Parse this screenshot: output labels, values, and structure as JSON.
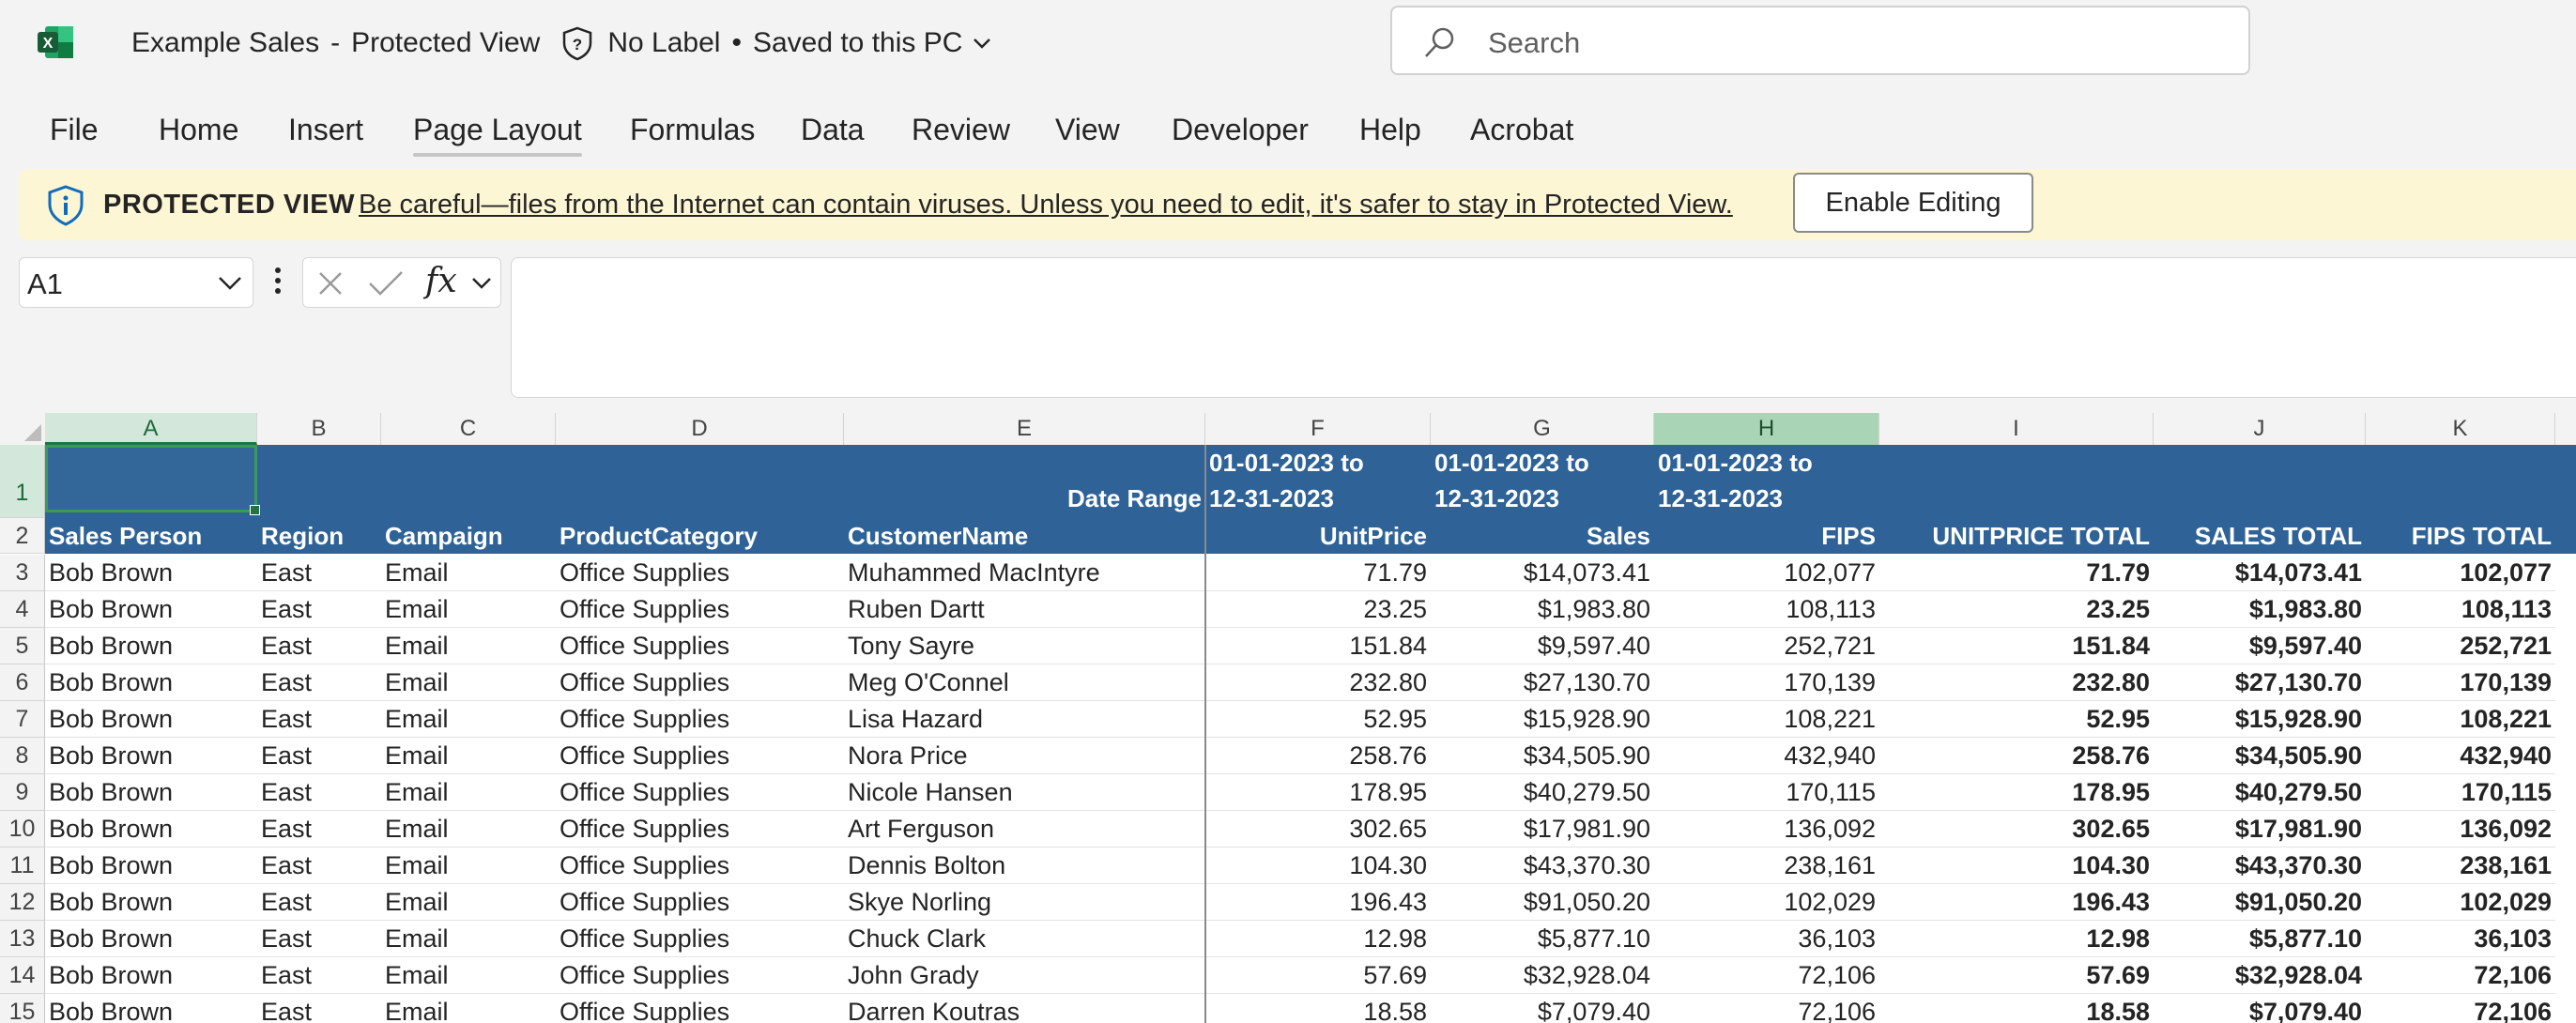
{
  "app": {
    "doc_name": "Example Sales",
    "separator": "-",
    "view_mode": "Protected View",
    "label": "No Label",
    "bullet": "•",
    "save_status": "Saved to this PC",
    "search_placeholder": "Search"
  },
  "ribbon_tabs": [
    "File",
    "Home",
    "Insert",
    "Page Layout",
    "Formulas",
    "Data",
    "Review",
    "View",
    "Developer",
    "Help",
    "Acrobat"
  ],
  "active_tab": "Page Layout",
  "protected_view": {
    "title": "PROTECTED VIEW",
    "message": "Be careful—files from the Internet can contain viruses. Unless you need to edit, it's safer to stay in Protected View.",
    "button": "Enable Editing"
  },
  "formula_bar": {
    "name_box": "A1",
    "fx": "fx",
    "formula": ""
  },
  "columns": [
    "A",
    "B",
    "C",
    "D",
    "E",
    "F",
    "G",
    "H",
    "I",
    "J",
    "K"
  ],
  "highlighted_column": "H",
  "row_numbers": [
    "1",
    "2",
    "3",
    "4",
    "5",
    "6",
    "7",
    "8",
    "9",
    "10",
    "11",
    "12",
    "13",
    "14",
    "15"
  ],
  "header_row1": {
    "date_range_label": "Date Range",
    "F_line1": "01-01-2023 to",
    "F_line2": "12-31-2023",
    "G_line1": "01-01-2023 to",
    "G_line2": "12-31-2023",
    "H_line1": "01-01-2023 to",
    "H_line2": "12-31-2023"
  },
  "header_row2": [
    "Sales Person",
    "Region",
    "Campaign",
    "ProductCategory",
    "CustomerName",
    "UnitPrice",
    "Sales",
    "FIPS",
    "UNITPRICE TOTAL",
    "SALES TOTAL",
    "FIPS TOTAL"
  ],
  "rows": [
    [
      "Bob Brown",
      "East",
      "Email",
      "Office Supplies",
      "Muhammed MacIntyre",
      "71.79",
      "$14,073.41",
      "102,077",
      "71.79",
      "$14,073.41",
      "102,077"
    ],
    [
      "Bob Brown",
      "East",
      "Email",
      "Office Supplies",
      "Ruben Dartt",
      "23.25",
      "$1,983.80",
      "108,113",
      "23.25",
      "$1,983.80",
      "108,113"
    ],
    [
      "Bob Brown",
      "East",
      "Email",
      "Office Supplies",
      "Tony Sayre",
      "151.84",
      "$9,597.40",
      "252,721",
      "151.84",
      "$9,597.40",
      "252,721"
    ],
    [
      "Bob Brown",
      "East",
      "Email",
      "Office Supplies",
      "Meg O'Connel",
      "232.80",
      "$27,130.70",
      "170,139",
      "232.80",
      "$27,130.70",
      "170,139"
    ],
    [
      "Bob Brown",
      "East",
      "Email",
      "Office Supplies",
      "Lisa Hazard",
      "52.95",
      "$15,928.90",
      "108,221",
      "52.95",
      "$15,928.90",
      "108,221"
    ],
    [
      "Bob Brown",
      "East",
      "Email",
      "Office Supplies",
      "Nora Price",
      "258.76",
      "$34,505.90",
      "432,940",
      "258.76",
      "$34,505.90",
      "432,940"
    ],
    [
      "Bob Brown",
      "East",
      "Email",
      "Office Supplies",
      "Nicole Hansen",
      "178.95",
      "$40,279.50",
      "170,115",
      "178.95",
      "$40,279.50",
      "170,115"
    ],
    [
      "Bob Brown",
      "East",
      "Email",
      "Office Supplies",
      "Art Ferguson",
      "302.65",
      "$17,981.90",
      "136,092",
      "302.65",
      "$17,981.90",
      "136,092"
    ],
    [
      "Bob Brown",
      "East",
      "Email",
      "Office Supplies",
      "Dennis Bolton",
      "104.30",
      "$43,370.30",
      "238,161",
      "104.30",
      "$43,370.30",
      "238,161"
    ],
    [
      "Bob Brown",
      "East",
      "Email",
      "Office Supplies",
      "Skye Norling",
      "196.43",
      "$91,050.20",
      "102,029",
      "196.43",
      "$91,050.20",
      "102,029"
    ],
    [
      "Bob Brown",
      "East",
      "Email",
      "Office Supplies",
      "Chuck Clark",
      "12.98",
      "$5,877.10",
      "36,103",
      "12.98",
      "$5,877.10",
      "36,103"
    ],
    [
      "Bob Brown",
      "East",
      "Email",
      "Office Supplies",
      "John Grady",
      "57.69",
      "$32,928.04",
      "72,106",
      "57.69",
      "$32,928.04",
      "72,106"
    ],
    [
      "Bob Brown",
      "East",
      "Email",
      "Office Supplies",
      "Darren Koutras",
      "18.58",
      "$7,079.40",
      "72,106",
      "18.58",
      "$7,079.40",
      "72,106"
    ]
  ]
}
